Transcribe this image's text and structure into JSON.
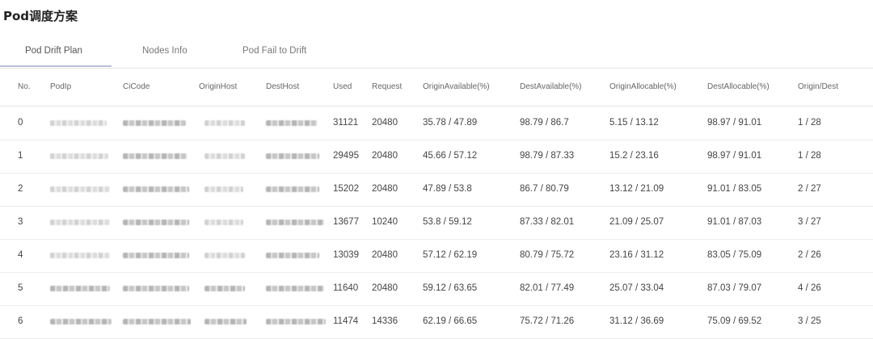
{
  "page": {
    "title": "Pod调度方案"
  },
  "tabs": [
    {
      "label": "Pod Drift Plan",
      "active": true
    },
    {
      "label": "Nodes Info",
      "active": false
    },
    {
      "label": "Pod Fail to Drift",
      "active": false
    }
  ],
  "table": {
    "columns": [
      "No.",
      "PodIp",
      "CiCode",
      "OriginHost",
      "DestHost",
      "Used",
      "Request",
      "OriginAvailable(%)",
      "DestAvailable(%)",
      "OriginAllocable(%)",
      "DestAllocable(%)",
      "Origin/Dest"
    ],
    "rows": [
      {
        "no": "0",
        "used": "31121",
        "request": "20480",
        "origin_available": "35.78 / 47.89",
        "dest_available": "98.79 / 86.7",
        "origin_allocable": "5.15 / 13.12",
        "dest_allocable": "98.97 / 91.01",
        "origin_dest": "1 / 28"
      },
      {
        "no": "1",
        "used": "29495",
        "request": "20480",
        "origin_available": "45.66 / 57.12",
        "dest_available": "98.79 / 87.33",
        "origin_allocable": "15.2 / 23.16",
        "dest_allocable": "98.97 / 91.01",
        "origin_dest": "1 / 28"
      },
      {
        "no": "2",
        "used": "15202",
        "request": "20480",
        "origin_available": "47.89 / 53.8",
        "dest_available": "86.7 / 80.79",
        "origin_allocable": "13.12 / 21.09",
        "dest_allocable": "91.01 / 83.05",
        "origin_dest": "2 / 27"
      },
      {
        "no": "3",
        "used": "13677",
        "request": "10240",
        "origin_available": "53.8 / 59.12",
        "dest_available": "87.33 / 82.01",
        "origin_allocable": "21.09 / 25.07",
        "dest_allocable": "91.01 / 87.03",
        "origin_dest": "3 / 27"
      },
      {
        "no": "4",
        "used": "13039",
        "request": "20480",
        "origin_available": "57.12 / 62.19",
        "dest_available": "80.79 / 75.72",
        "origin_allocable": "23.16 / 31.12",
        "dest_allocable": "83.05 / 75.09",
        "origin_dest": "2 / 26"
      },
      {
        "no": "5",
        "used": "11640",
        "request": "20480",
        "origin_available": "59.12 / 63.65",
        "dest_available": "82.01 / 77.49",
        "origin_allocable": "25.07 / 33.04",
        "dest_allocable": "87.03 / 79.07",
        "origin_dest": "4 / 26"
      },
      {
        "no": "6",
        "used": "11474",
        "request": "14336",
        "origin_available": "62.19 / 66.65",
        "dest_available": "75.72 / 71.26",
        "origin_allocable": "31.12 / 36.69",
        "dest_allocable": "75.09 / 69.52",
        "origin_dest": "3 / 25"
      }
    ]
  }
}
